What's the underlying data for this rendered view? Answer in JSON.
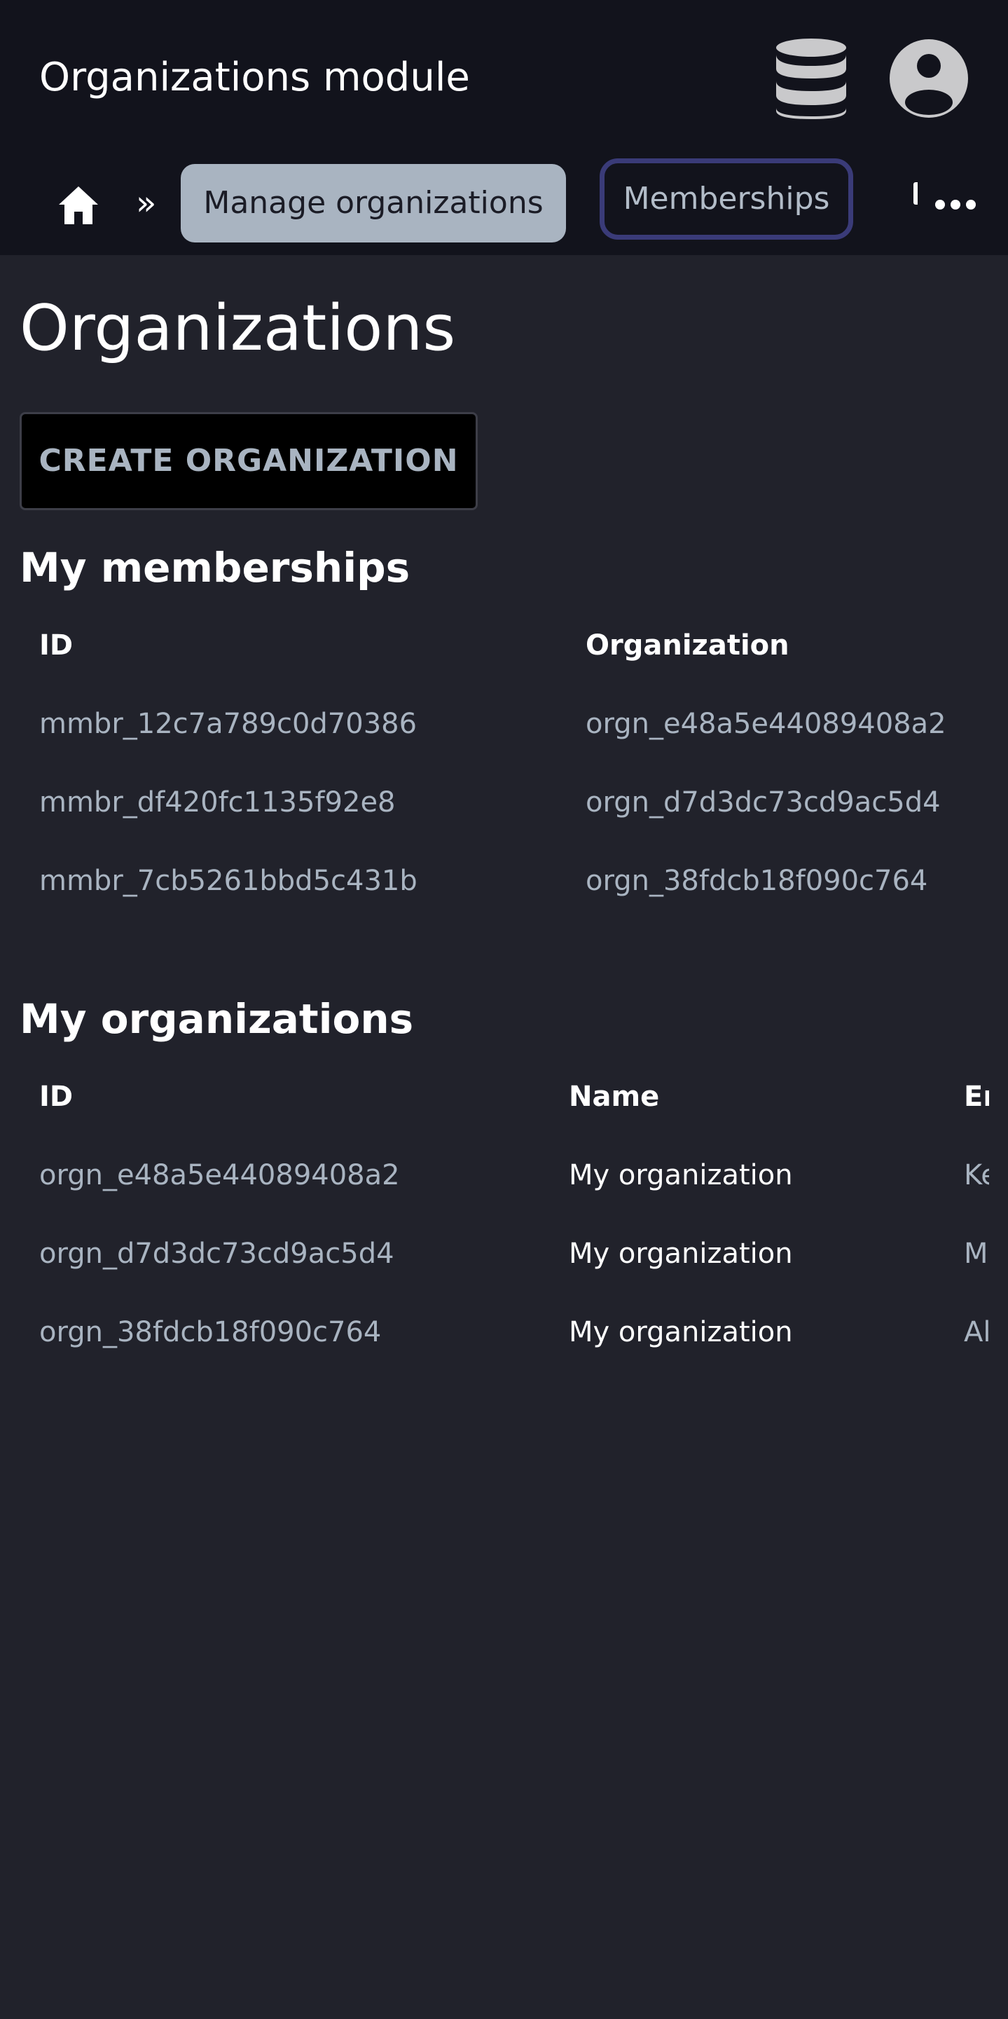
{
  "header": {
    "title": "Organizations module",
    "database_icon": "database-icon",
    "account_icon": "account-circle-icon"
  },
  "breadcrumb": {
    "home_icon": "home-icon",
    "separator": "»",
    "tabs": [
      {
        "label": "Manage organizations",
        "state": "selected"
      },
      {
        "label": "Memberships",
        "state": "focused"
      }
    ],
    "more_icon": "more-horizontal-icon"
  },
  "page": {
    "title": "Organizations",
    "create_button_label": "CREATE ORGANIZATION"
  },
  "memberships": {
    "title": "My memberships",
    "columns": [
      "ID",
      "Organization"
    ],
    "rows": [
      [
        "mmbr_12c7a789c0d70386",
        "orgn_e48a5e44089408a2"
      ],
      [
        "mmbr_df420fc1135f92e8",
        "orgn_d7d3dc73cd9ac5d4"
      ],
      [
        "mmbr_7cb5261bbd5c431b",
        "orgn_38fdcb18f090c764"
      ]
    ]
  },
  "organizations": {
    "title": "My organizations",
    "columns": [
      "ID",
      "Name",
      "Email"
    ],
    "rows": [
      [
        "orgn_e48a5e44089408a2",
        "My organization",
        "Ke"
      ],
      [
        "orgn_d7d3dc73cd9ac5d4",
        "My organization",
        "M"
      ],
      [
        "orgn_38fdcb18f090c764",
        "My organization",
        "Al"
      ]
    ]
  },
  "colors": {
    "header_bg": "#12131c",
    "page_bg": "#21222b",
    "selected_tab_bg": "#a9b4c1",
    "focus_ring": "#3a3b78",
    "muted_text": "#a9b4c1"
  }
}
